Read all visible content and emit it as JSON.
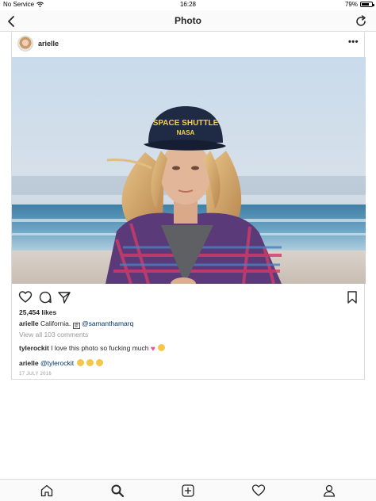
{
  "status_bar": {
    "carrier": "No Service",
    "time": "16:28",
    "battery": "79%",
    "battery_level": 0.79
  },
  "nav": {
    "title": "Photo",
    "back_icon": "chevron-left-icon",
    "refresh_icon": "refresh-icon"
  },
  "post": {
    "username": "arielle",
    "more_label": "•••",
    "likes": "25,454 likes",
    "caption": {
      "username": "arielle",
      "text": "California.",
      "mention": "@samanthamarq"
    },
    "view_comments": "View all 103 comments",
    "comments": [
      {
        "username": "tylerockit",
        "text": "I love this photo so fucking much"
      },
      {
        "username": "arielle",
        "mention": "@tylerockit"
      }
    ],
    "date": "17 JULY 2016",
    "hat_text_top": "SPACE SHUTTLE",
    "hat_text_bottom": "NASA"
  },
  "tab_bar": {
    "items": [
      "home-icon",
      "search-icon",
      "add-icon",
      "heart-icon",
      "profile-icon"
    ],
    "active": "search-icon"
  }
}
